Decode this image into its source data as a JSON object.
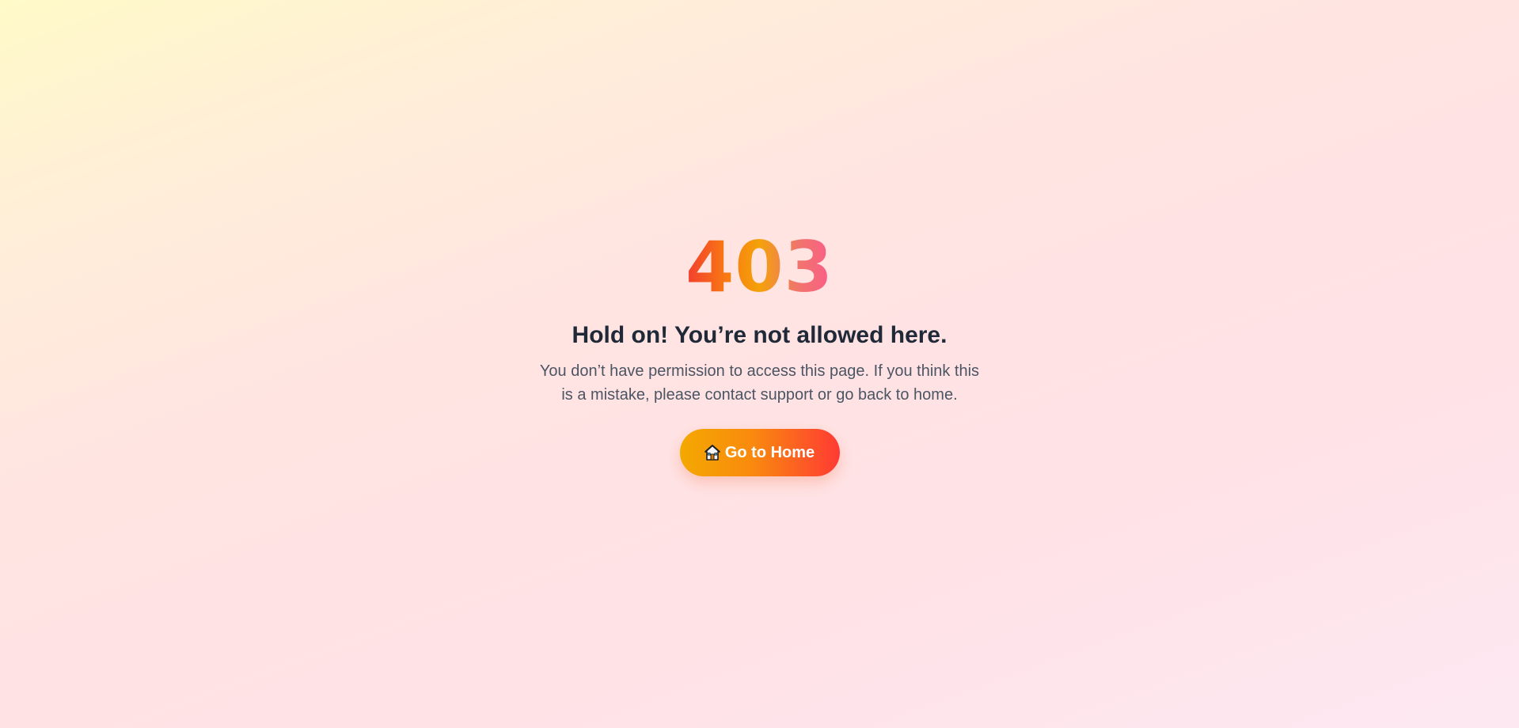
{
  "error": {
    "code": "403",
    "headline": "Hold on! You’re not allowed here.",
    "message": "You don’t have permission to access this page. If you think this is a mistake, please contact support or go back to home."
  },
  "home_button": {
    "icon": "house-icon",
    "label": "Go to Home"
  },
  "colors": {
    "gradient_start": "#f4a800",
    "gradient_end": "#ff3a34",
    "heading": "#1f2937",
    "text": "#4b5563"
  }
}
